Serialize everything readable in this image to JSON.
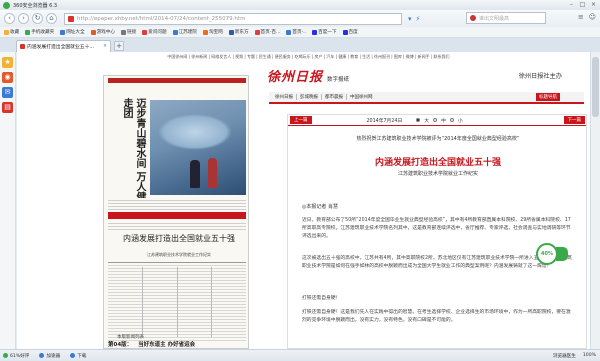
{
  "window": {
    "title": "360安全浏览器 6.3"
  },
  "address": {
    "url": "http://epaper.xhby.net/html/2014-07/24/content_255079.htm"
  },
  "search": {
    "placeholder": "谁出文明最高"
  },
  "bookmarks": [
    {
      "label": "收藏",
      "color": "#f2b233"
    },
    {
      "label": "手机收藏夹",
      "color": "#3aa94a"
    },
    {
      "label": "网址大全",
      "color": "#3a7bd5"
    },
    {
      "label": "游戏中心",
      "color": "#e25a2b"
    },
    {
      "label": "链接",
      "color": "#777777"
    },
    {
      "label": "爱问问题",
      "color": "#e23b3b"
    },
    {
      "label": "江苏建院",
      "color": "#3a7bd5"
    },
    {
      "label": "淘宝网",
      "color": "#f26a1b"
    },
    {
      "label": "新东方",
      "color": "#2a5caa"
    },
    {
      "label": "首页-百...",
      "color": "#e23b3b"
    },
    {
      "label": "首页-..",
      "color": "#3a7bd5"
    },
    {
      "label": "百度一下",
      "color": "#2932e1"
    },
    {
      "label": "百度",
      "color": "#2932e1"
    }
  ],
  "tab": {
    "title": "内涵发展打造出全国就业五十..."
  },
  "site": {
    "nav": "中国徐州网 | 徐州新闻 | 网络发言人 | 视频 | 专题 | 民生通 | 便民服务 | 吃喝玩乐 | 房产 | 汽车 | 健康 | 教育 | 生活 | 徐州报刊 | 图库 | 微博 | 新闻手 | 联系我们",
    "brand": "徐州日报",
    "brand_sub": "数字报纸",
    "host": "徐州日报社主办",
    "menu": [
      "徐州日报",
      "彭城晚报",
      "都市晨报",
      "中国徐州网"
    ],
    "menu_button": "标题导航"
  },
  "paper": {
    "vertical_head": "迈步青山碧水间 万人健走团",
    "head2": "内涵发展打造出全国就业五十强",
    "sub2": "江苏建筑职业技术学院就业工作纪实",
    "footer_page": "第04版：",
    "footer_title": "当好东道主 办好省运会",
    "pager": "本版新闻列表"
  },
  "article": {
    "prev": "上一篇",
    "next": "下一篇",
    "date": "2014年7月24日",
    "font_large": "大",
    "font_mid": "中",
    "font_small": "小",
    "kicker": "热烈祝贺江苏建筑职业技术学院被评为“2014年度全国就业典型经验高校”",
    "title": "内涵发展打造出全国就业五十强",
    "subtitle": "江苏建筑职业技术学院就业工作纪实",
    "byline": "◎本报记者  肖慧",
    "paragraphs": [
      "近日，教育部公布了50所“2014年度全国毕业生就业典型经验高校”，其中有4所教育部直属本科院校、29所省属本科院校、17所高职高专院校。江苏建筑职业技术学院名列其中，这是教育部连续评选中，省厅推荐、专家评选，社会调查与实地调研等环节评选出来的。",
      "这次被选出五十强的高校中，江苏共有4所，其中高职院校2所。苏北地区仅有江苏建筑职业技术学院一所进入五十强。江苏建筑职业技术学院是如何在强手如林的高校中脱颖而出成为全国大学生就业工作的典型案例呢？内涵发展铸就了这一辉煌！",
      "打铁还需自身硬！",
      "打铁还需自身硬！这是我们先人在实践中得出的智慧。在考生选择学校、企业选择生的市场环境中，作为一所高职院校，要在激烈的竞争环境中脱颖而出，没有实力，没有特色，没有口碑是不可能的。"
    ]
  },
  "float": {
    "percent": "40%"
  },
  "status": {
    "left1": "61%好评",
    "left2": "加速器",
    "left3": "下载",
    "right1": "浏览器医生",
    "zoom": "100%"
  }
}
